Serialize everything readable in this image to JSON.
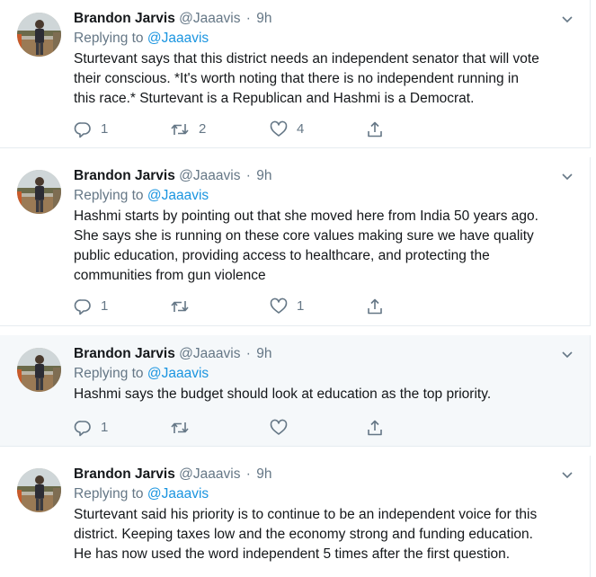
{
  "replying_prefix": "Replying to",
  "tweets": [
    {
      "name": "Brandon Jarvis",
      "handle": "@Jaaavis",
      "dot": "·",
      "time": "9h",
      "reply_to": "@Jaaavis",
      "lines": [
        "Sturtevant says that this district needs an independent senator that will vote",
        "their conscious. *It's worth noting that there is no independent running in",
        "this race.* Sturtevant is a Republican and Hashmi is a Democrat."
      ],
      "reply_count": "1",
      "retweet_count": "2",
      "like_count": "4"
    },
    {
      "name": "Brandon Jarvis",
      "handle": "@Jaaavis",
      "dot": "·",
      "time": "9h",
      "reply_to": "@Jaaavis",
      "lines": [
        "Hashmi starts by pointing out that she moved here from India 50 years ago.",
        "She says she is running on these core values making sure we have quality",
        "public education, providing access to healthcare, and protecting the",
        "communities from gun violence"
      ],
      "reply_count": "1",
      "retweet_count": "",
      "like_count": "1"
    },
    {
      "name": "Brandon Jarvis",
      "handle": "@Jaaavis",
      "dot": "·",
      "time": "9h",
      "reply_to": "@Jaaavis",
      "lines": [
        "Hashmi says the budget should look at education as the top priority."
      ],
      "reply_count": "1",
      "retweet_count": "",
      "like_count": ""
    },
    {
      "name": "Brandon Jarvis",
      "handle": "@Jaaavis",
      "dot": "·",
      "time": "9h",
      "reply_to": "@Jaaavis",
      "lines": [
        "Sturtevant said his priority is to continue to be an independent voice for this",
        "district. Keeping taxes low and the economy strong and funding education.",
        "He has now used the word independent 5 times after the first question."
      ],
      "reply_count": "",
      "retweet_count": "",
      "like_count": ""
    }
  ],
  "icons": {
    "reply": "reply-icon",
    "retweet": "retweet-icon",
    "like": "heart-icon",
    "share": "share-icon",
    "caret": "chevron-down-icon"
  },
  "colors": {
    "text": "#14171a",
    "muted": "#657786",
    "link": "#1b95e0",
    "divider": "#e6ecf0",
    "shaded_bg": "#f5f8fa"
  }
}
